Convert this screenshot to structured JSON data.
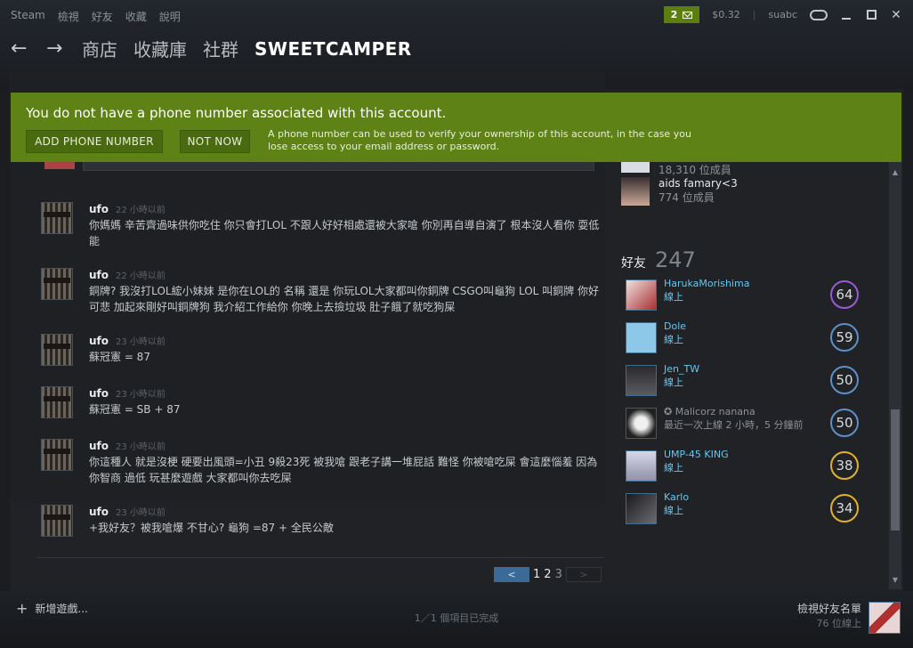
{
  "menu": [
    "Steam",
    "檢視",
    "好友",
    "收藏",
    "說明"
  ],
  "window": {
    "notifications": "2",
    "wallet": "$0.32",
    "username": "suabc"
  },
  "nav": {
    "store": "商店",
    "library": "收藏庫",
    "community": "社群",
    "current": "SWEETCAMPER"
  },
  "banner": {
    "title": "You do not have a phone number associated with this account.",
    "add_button": "ADD PHONE NUMBER",
    "not_now_button": "NOT NOW",
    "description": "A phone number can be used to verify your ownership of this account, in the case you lose access to your email address or password."
  },
  "comments": [
    {
      "name": "ufo",
      "time": "22 小時以前",
      "text": "你媽媽 辛苦齊過味供你吃住 你只會打LOL 不跟人好好相處還被大家嗆 你別再自導自演了 根本沒人看你 耍低能"
    },
    {
      "name": "ufo",
      "time": "22 小時以前",
      "text": "銅牌? 我沒打LOL綋小妹妹 是你在LOL的 名稱 還是 你玩LOL大家都叫你銅牌 CSGO叫龜狗 LOL 叫銅牌 你好可悲 加起來剛好叫銅牌狗 我介紹工作給你 你晚上去撿垃圾 肚子餓了就吃狗屎"
    },
    {
      "name": "ufo",
      "time": "23 小時以前",
      "text": "蘇冠憲 = 87"
    },
    {
      "name": "ufo",
      "time": "23 小時以前",
      "text": "蘇冠憲 = SB + 87"
    },
    {
      "name": "ufo",
      "time": "23 小時以前",
      "text": "你這種人 就是沒梗 硬要出風頭=小丑 9殺23死 被我嗆 跟老子講一堆屁話 難怪 你被嗆吃屎 會這麼惱羞 因為你智商 過低 玩甚麼遊戲 大家都叫你去吃屎"
    },
    {
      "name": "ufo",
      "time": "23 小時以前",
      "text": "+我好友？被我嗆爆 不甘心? 龜狗 =87 + 全民公敵"
    }
  ],
  "pagination": {
    "prev": "<",
    "pages": [
      "1",
      "2",
      "3"
    ],
    "next": ">"
  },
  "groups": [
    {
      "name": "",
      "members": "18,310 位成員"
    },
    {
      "name": "aids famary<3",
      "members": "774 位成員"
    }
  ],
  "friends_section": {
    "label": "好友",
    "count": "247"
  },
  "friends": [
    {
      "name": "HarukaMorishima",
      "status": "線上",
      "level": "64",
      "color": "#9b59d6"
    },
    {
      "name": "Dole",
      "status": "線上",
      "level": "59",
      "color": "#5f8fc7"
    },
    {
      "name": "Jen_TW",
      "status": "線上",
      "level": "50",
      "color": "#5f8fc7"
    },
    {
      "name": "✪ Malicorz nanana",
      "status": "最近一次上線 2 小時，5 分鐘前",
      "level": "50",
      "color": "#5f8fc7"
    },
    {
      "name": "UMP-45 KING",
      "status": "線上",
      "level": "38",
      "color": "#e1b12c"
    },
    {
      "name": "Karlo",
      "status": "線上",
      "level": "34",
      "color": "#e1b12c"
    }
  ],
  "bottom": {
    "add_game": "新增遊戲...",
    "download_status": "1／1 個項目已完成",
    "view_friends": "檢視好友名單",
    "online_count": "76 位線上"
  },
  "colors": {
    "banner_green": "#5e8215",
    "online_blue": "#62c8f2"
  }
}
